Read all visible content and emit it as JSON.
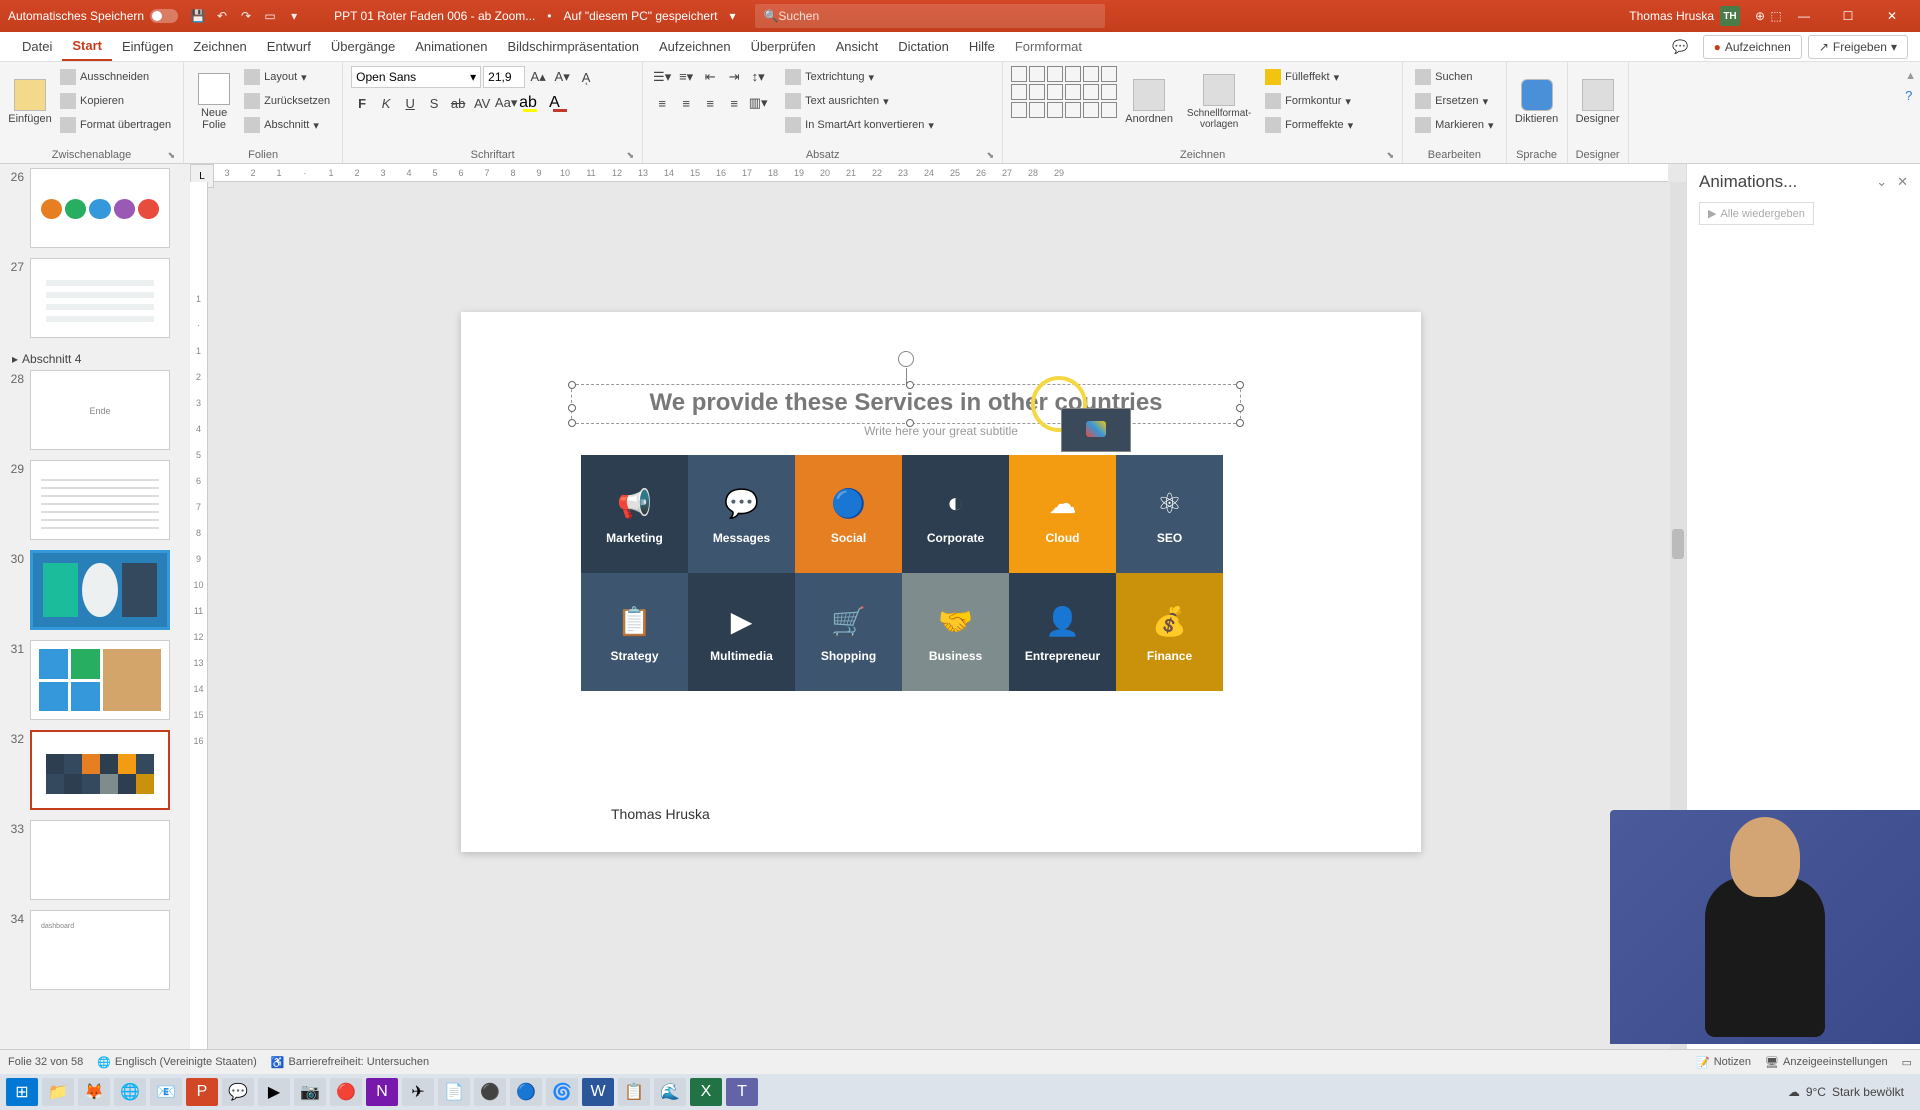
{
  "titlebar": {
    "autosave": "Automatisches Speichern",
    "doc": "PPT 01 Roter Faden 006 - ab Zoom...",
    "saved": "Auf \"diesem PC\" gespeichert",
    "search_placeholder": "Suchen",
    "user": "Thomas Hruska",
    "user_initials": "TH"
  },
  "tabs": {
    "items": [
      "Datei",
      "Start",
      "Einfügen",
      "Zeichnen",
      "Entwurf",
      "Übergänge",
      "Animationen",
      "Bildschirmpräsentation",
      "Aufzeichnen",
      "Überprüfen",
      "Ansicht",
      "Dictation",
      "Hilfe",
      "Formformat"
    ],
    "active_index": 1,
    "record": "Aufzeichnen",
    "share": "Freigeben"
  },
  "ribbon": {
    "clipboard": {
      "label": "Zwischenablage",
      "paste": "Einfügen",
      "cut": "Ausschneiden",
      "copy": "Kopieren",
      "format_painter": "Format übertragen"
    },
    "slides": {
      "label": "Folien",
      "new_slide": "Neue\nFolie",
      "layout": "Layout",
      "reset": "Zurücksetzen",
      "section": "Abschnitt"
    },
    "font": {
      "label": "Schriftart",
      "name": "Open Sans",
      "size": "21,9"
    },
    "paragraph": {
      "label": "Absatz",
      "direction": "Textrichtung",
      "align": "Text ausrichten",
      "smartart": "In SmartArt konvertieren"
    },
    "drawing": {
      "label": "Zeichnen",
      "arrange": "Anordnen",
      "quickstyles": "Schnellformat-\nvorlagen",
      "fill": "Fülleffekt",
      "outline": "Formkontur",
      "effects": "Formeffekte"
    },
    "editing": {
      "label": "Bearbeiten",
      "find": "Suchen",
      "replace": "Ersetzen",
      "select": "Markieren"
    },
    "voice": {
      "label": "Sprache",
      "dictate": "Diktieren"
    },
    "designer": {
      "label": "Designer",
      "btn": "Designer"
    }
  },
  "thumbs": {
    "section": "Abschnitt 4",
    "ende": "Ende",
    "items": [
      {
        "num": "26"
      },
      {
        "num": "27"
      },
      {
        "num": "28"
      },
      {
        "num": "29"
      },
      {
        "num": "30"
      },
      {
        "num": "31"
      },
      {
        "num": "32"
      },
      {
        "num": "33"
      },
      {
        "num": "34"
      }
    ]
  },
  "slide": {
    "title": "We provide these Services in other countries",
    "subtitle": "Write here your great subtitle",
    "author": "Thomas Hruska",
    "tiles": [
      {
        "label": "Marketing",
        "bg": "bg-navy"
      },
      {
        "label": "Messages",
        "bg": "bg-steel"
      },
      {
        "label": "Social",
        "bg": "bg-orange"
      },
      {
        "label": "Corporate",
        "bg": "bg-navy"
      },
      {
        "label": "Cloud",
        "bg": "bg-amber"
      },
      {
        "label": "SEO",
        "bg": "bg-steel"
      },
      {
        "label": "Strategy",
        "bg": "bg-steel"
      },
      {
        "label": "Multimedia",
        "bg": "bg-navy"
      },
      {
        "label": "Shopping",
        "bg": "bg-steel"
      },
      {
        "label": "Business",
        "bg": "bg-gray"
      },
      {
        "label": "Entrepreneur",
        "bg": "bg-navy"
      },
      {
        "label": "Finance",
        "bg": "bg-amber2"
      }
    ]
  },
  "panel": {
    "title": "Animations...",
    "replay": "Alle wiedergeben"
  },
  "statusbar": {
    "slide_info": "Folie 32 von 58",
    "language": "Englisch (Vereinigte Staaten)",
    "accessibility": "Barrierefreiheit: Untersuchen",
    "notes": "Notizen",
    "display": "Anzeigeeinstellungen"
  },
  "weather": {
    "temp": "9°C",
    "cond": "Stark bewölkt"
  }
}
